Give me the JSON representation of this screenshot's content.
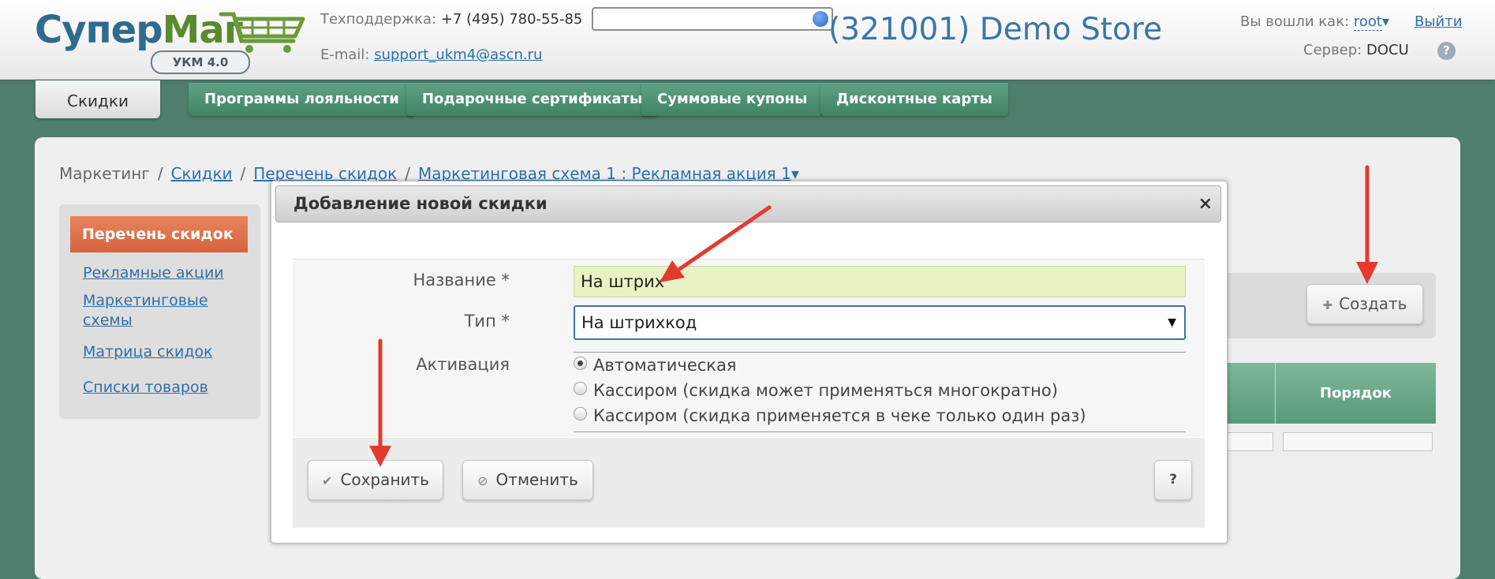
{
  "brand": {
    "logo_part1": "Супер",
    "logo_part2": "Маг",
    "badge": "УКМ 4.0"
  },
  "header": {
    "support_label": "Техподдержка:",
    "support_phone": "+7 (495) 780-55-85",
    "email_label": "E-mail:",
    "email": "support_ukm4@ascn.ru",
    "search_value": "",
    "store_title": "(321001) Demo Store",
    "login_label": "Вы вошли как:",
    "login_user": "root",
    "login_caret": "▾",
    "logout": "Выйти",
    "server_label": "Сервер:",
    "server_value": "DOCU",
    "help_icon": "?"
  },
  "tabs": [
    {
      "label": "Скидки",
      "active": true
    },
    {
      "label": "Программы лояльности"
    },
    {
      "label": "Подарочные сертификаты"
    },
    {
      "label": "Суммовые купоны"
    },
    {
      "label": "Дисконтные карты"
    }
  ],
  "breadcrumb": {
    "root": "Маркетинг",
    "sep": "/",
    "item1": "Скидки",
    "item2": "Перечень скидок",
    "item3": "Маркетинговая схема 1 : Рекламная акция 1",
    "caret": "▾"
  },
  "sidebar": {
    "active": "Перечень скидок",
    "items": [
      "Рекламные акции",
      "Маркетинговые схемы",
      "Матрица скидок",
      "Списки товаров"
    ]
  },
  "toolbar": {
    "create_icon": "✚",
    "create_label": "Создать"
  },
  "table": {
    "order_header": "Порядок"
  },
  "dialog": {
    "title": "Добавление новой скидки",
    "close": "×",
    "name_label": "Название *",
    "name_value": "На штрих",
    "type_label": "Тип *",
    "type_value": "На штрихкод",
    "type_arrow": "▼",
    "activation_label": "Активация",
    "activation_options": [
      "Автоматическая",
      "Кассиром (скидка может применяться многократно)",
      "Кассиром (скидка применяется в чеке только один раз)"
    ],
    "activation_selected": 0,
    "save_icon": "✔",
    "save_label": "Сохранить",
    "cancel_icon": "⊘",
    "cancel_label": "Отменить",
    "help_label": "?"
  },
  "colors": {
    "background": "#507e6c",
    "tab_green": "#4f9272",
    "accent_blue": "#2f6fa8",
    "active_orange": "#d4633e",
    "name_input_bg": "#e7f3c2",
    "arrow_red": "#e53a2e"
  }
}
